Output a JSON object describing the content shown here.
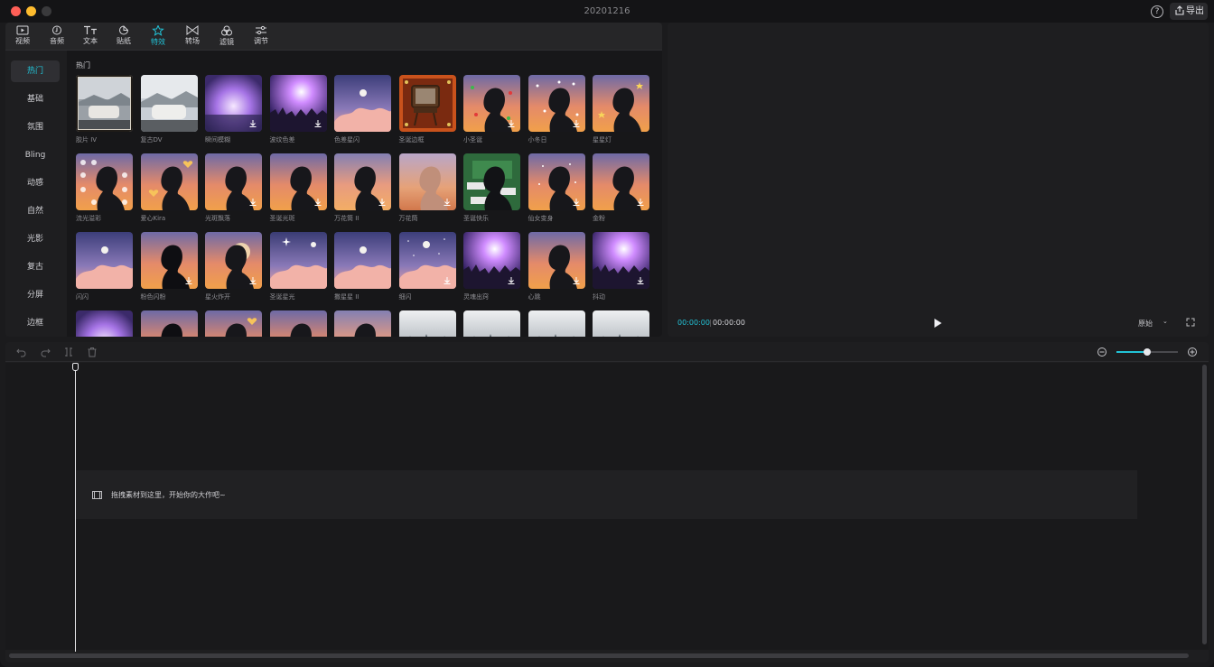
{
  "window": {
    "title": "20201216"
  },
  "header": {
    "help_symbol": "?",
    "export_label": "导出"
  },
  "tabs": [
    {
      "label": "视频",
      "icon": "video-icon"
    },
    {
      "label": "音频",
      "icon": "audio-icon"
    },
    {
      "label": "文本",
      "icon": "text-icon"
    },
    {
      "label": "贴纸",
      "icon": "sticker-icon"
    },
    {
      "label": "特效",
      "icon": "effects-icon",
      "active": true
    },
    {
      "label": "转场",
      "icon": "transition-icon"
    },
    {
      "label": "滤镜",
      "icon": "filter-icon"
    },
    {
      "label": "调节",
      "icon": "adjust-icon"
    }
  ],
  "categories": [
    {
      "label": "热门",
      "active": true
    },
    {
      "label": "基础"
    },
    {
      "label": "氛围"
    },
    {
      "label": "Bling"
    },
    {
      "label": "动感"
    },
    {
      "label": "自然"
    },
    {
      "label": "光影"
    },
    {
      "label": "复古"
    },
    {
      "label": "分屏"
    },
    {
      "label": "边框"
    }
  ],
  "effects_section": {
    "title": "热门"
  },
  "effects": [
    {
      "label": "胶片 IV",
      "theme": "car-frame",
      "download": false
    },
    {
      "label": "复古DV",
      "theme": "car",
      "download": false
    },
    {
      "label": "瞬间模糊",
      "theme": "purple-blur",
      "download": true
    },
    {
      "label": "波纹色差",
      "theme": "concert",
      "download": true
    },
    {
      "label": "色差星闪",
      "theme": "clouds",
      "download": false
    },
    {
      "label": "圣诞边框",
      "theme": "tv",
      "download": false
    },
    {
      "label": "小圣诞",
      "theme": "silhouette-xmas",
      "download": true
    },
    {
      "label": "小冬日",
      "theme": "silhouette-snow",
      "download": true
    },
    {
      "label": "星星灯",
      "theme": "silhouette-stars",
      "download": false
    },
    {
      "label": "流光溢彩",
      "theme": "silhouette-bokeh",
      "download": false
    },
    {
      "label": "爱心Kira",
      "theme": "silhouette-hearts",
      "download": false
    },
    {
      "label": "光斑飘落",
      "theme": "silhouette-orange",
      "download": true
    },
    {
      "label": "圣诞光斑",
      "theme": "silhouette-orange",
      "download": true
    },
    {
      "label": "万花筒 II",
      "theme": "silhouette-light",
      "download": true
    },
    {
      "label": "万花筒",
      "theme": "blur-orange",
      "download": true
    },
    {
      "label": "圣诞快乐",
      "theme": "green-merry",
      "download": false
    },
    {
      "label": "仙女变身",
      "theme": "silhouette-sparkle",
      "download": true
    },
    {
      "label": "金粉",
      "theme": "silhouette-orange",
      "download": true
    },
    {
      "label": "闪闪",
      "theme": "clouds",
      "download": false
    },
    {
      "label": "粉色闪粉",
      "theme": "silhouette-dark",
      "download": true
    },
    {
      "label": "星火炸开",
      "theme": "silhouette-burst",
      "download": true
    },
    {
      "label": "圣诞星光",
      "theme": "clouds-star",
      "download": false
    },
    {
      "label": "撒星星 II",
      "theme": "clouds",
      "download": false
    },
    {
      "label": "细闪",
      "theme": "clouds-sparkle",
      "download": true
    },
    {
      "label": "灵魂出窍",
      "theme": "concert",
      "download": true
    },
    {
      "label": "心跳",
      "theme": "purple-glow",
      "download": true
    },
    {
      "label": "抖动",
      "theme": "concert",
      "download": true
    },
    {
      "label": "",
      "theme": "purple-blur",
      "download": false
    },
    {
      "label": "",
      "theme": "silhouette-dark",
      "download": false
    },
    {
      "label": "",
      "theme": "silhouette-hearts",
      "download": false
    },
    {
      "label": "",
      "theme": "silhouette-orange",
      "download": false
    },
    {
      "label": "",
      "theme": "silhouette-light",
      "download": false
    },
    {
      "label": "",
      "theme": "forest",
      "download": false
    },
    {
      "label": "",
      "theme": "forest",
      "download": false
    },
    {
      "label": "",
      "theme": "forest",
      "download": false
    },
    {
      "label": "",
      "theme": "forest",
      "download": false
    }
  ],
  "preview": {
    "current_time": "00:00:00",
    "separator": "|",
    "total_time": "00:00:00",
    "ratio_label": "原始",
    "ratio_arrow": "⌄"
  },
  "timeline": {
    "drop_hint": "拖拽素材到这里，开始你的大作吧~",
    "zoom_level": 0.5
  },
  "colors": {
    "accent": "#22c3d7",
    "background": "#1b1b1d",
    "panel": "#1e1e20"
  }
}
